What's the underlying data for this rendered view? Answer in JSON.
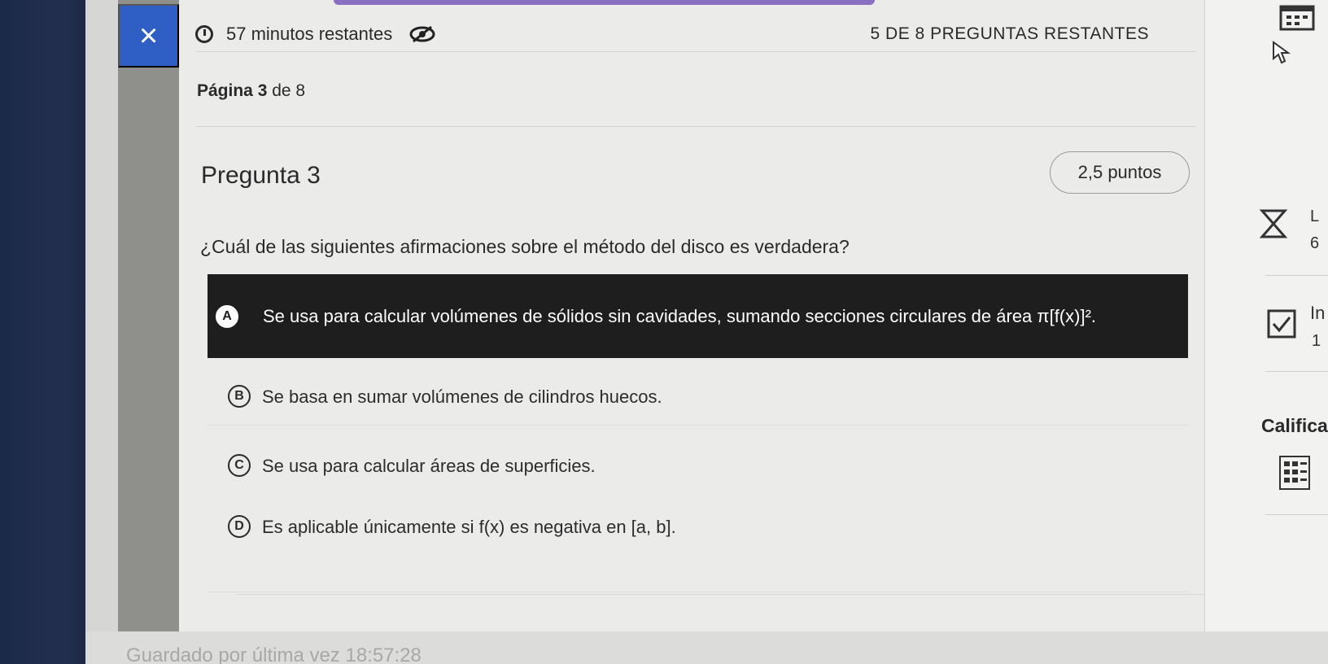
{
  "header": {
    "close_label": "×",
    "time_remaining": "57 minutos restantes",
    "questions_remaining": "5 DE 8 PREGUNTAS RESTANTES"
  },
  "page_info": {
    "label": "Página",
    "current": "3",
    "of": "de 8"
  },
  "question": {
    "title": "Pregunta 3",
    "points": "2,5 puntos",
    "text": "¿Cuál de las siguientes afirmaciones sobre el método del disco es verdadera?",
    "options": [
      {
        "letter": "A",
        "text": "Se usa para calcular volúmenes de sólidos sin cavidades, sumando secciones circulares de área π[f(x)]².",
        "selected": true
      },
      {
        "letter": "B",
        "text": "Se basa en sumar volúmenes de cilindros huecos.",
        "selected": false
      },
      {
        "letter": "C",
        "text": "Se usa para calcular áreas de superficies.",
        "selected": false
      },
      {
        "letter": "D",
        "text": "Es aplicable únicamente si f(x) es negativa en [a, b].",
        "selected": false
      }
    ]
  },
  "right_panel": {
    "letter_l": "L",
    "digit_6": "6",
    "label_in": "In",
    "digit_1": "1",
    "califica": "Califica"
  },
  "footer": {
    "saved_text": "Guardado por última vez 18:57:28"
  },
  "icons": {
    "close": "close-icon",
    "timer": "timer-icon",
    "visibility": "eye-slash-icon",
    "calendar": "calendar-icon",
    "cursor": "cursor-icon",
    "hourglass": "hourglass-icon",
    "check": "check-icon",
    "grid": "grid-icon"
  },
  "colors": {
    "accent_blue": "#2f5fc4",
    "accent_purple": "#8a6fc1",
    "selected_option_bg": "#1e1e1e"
  }
}
